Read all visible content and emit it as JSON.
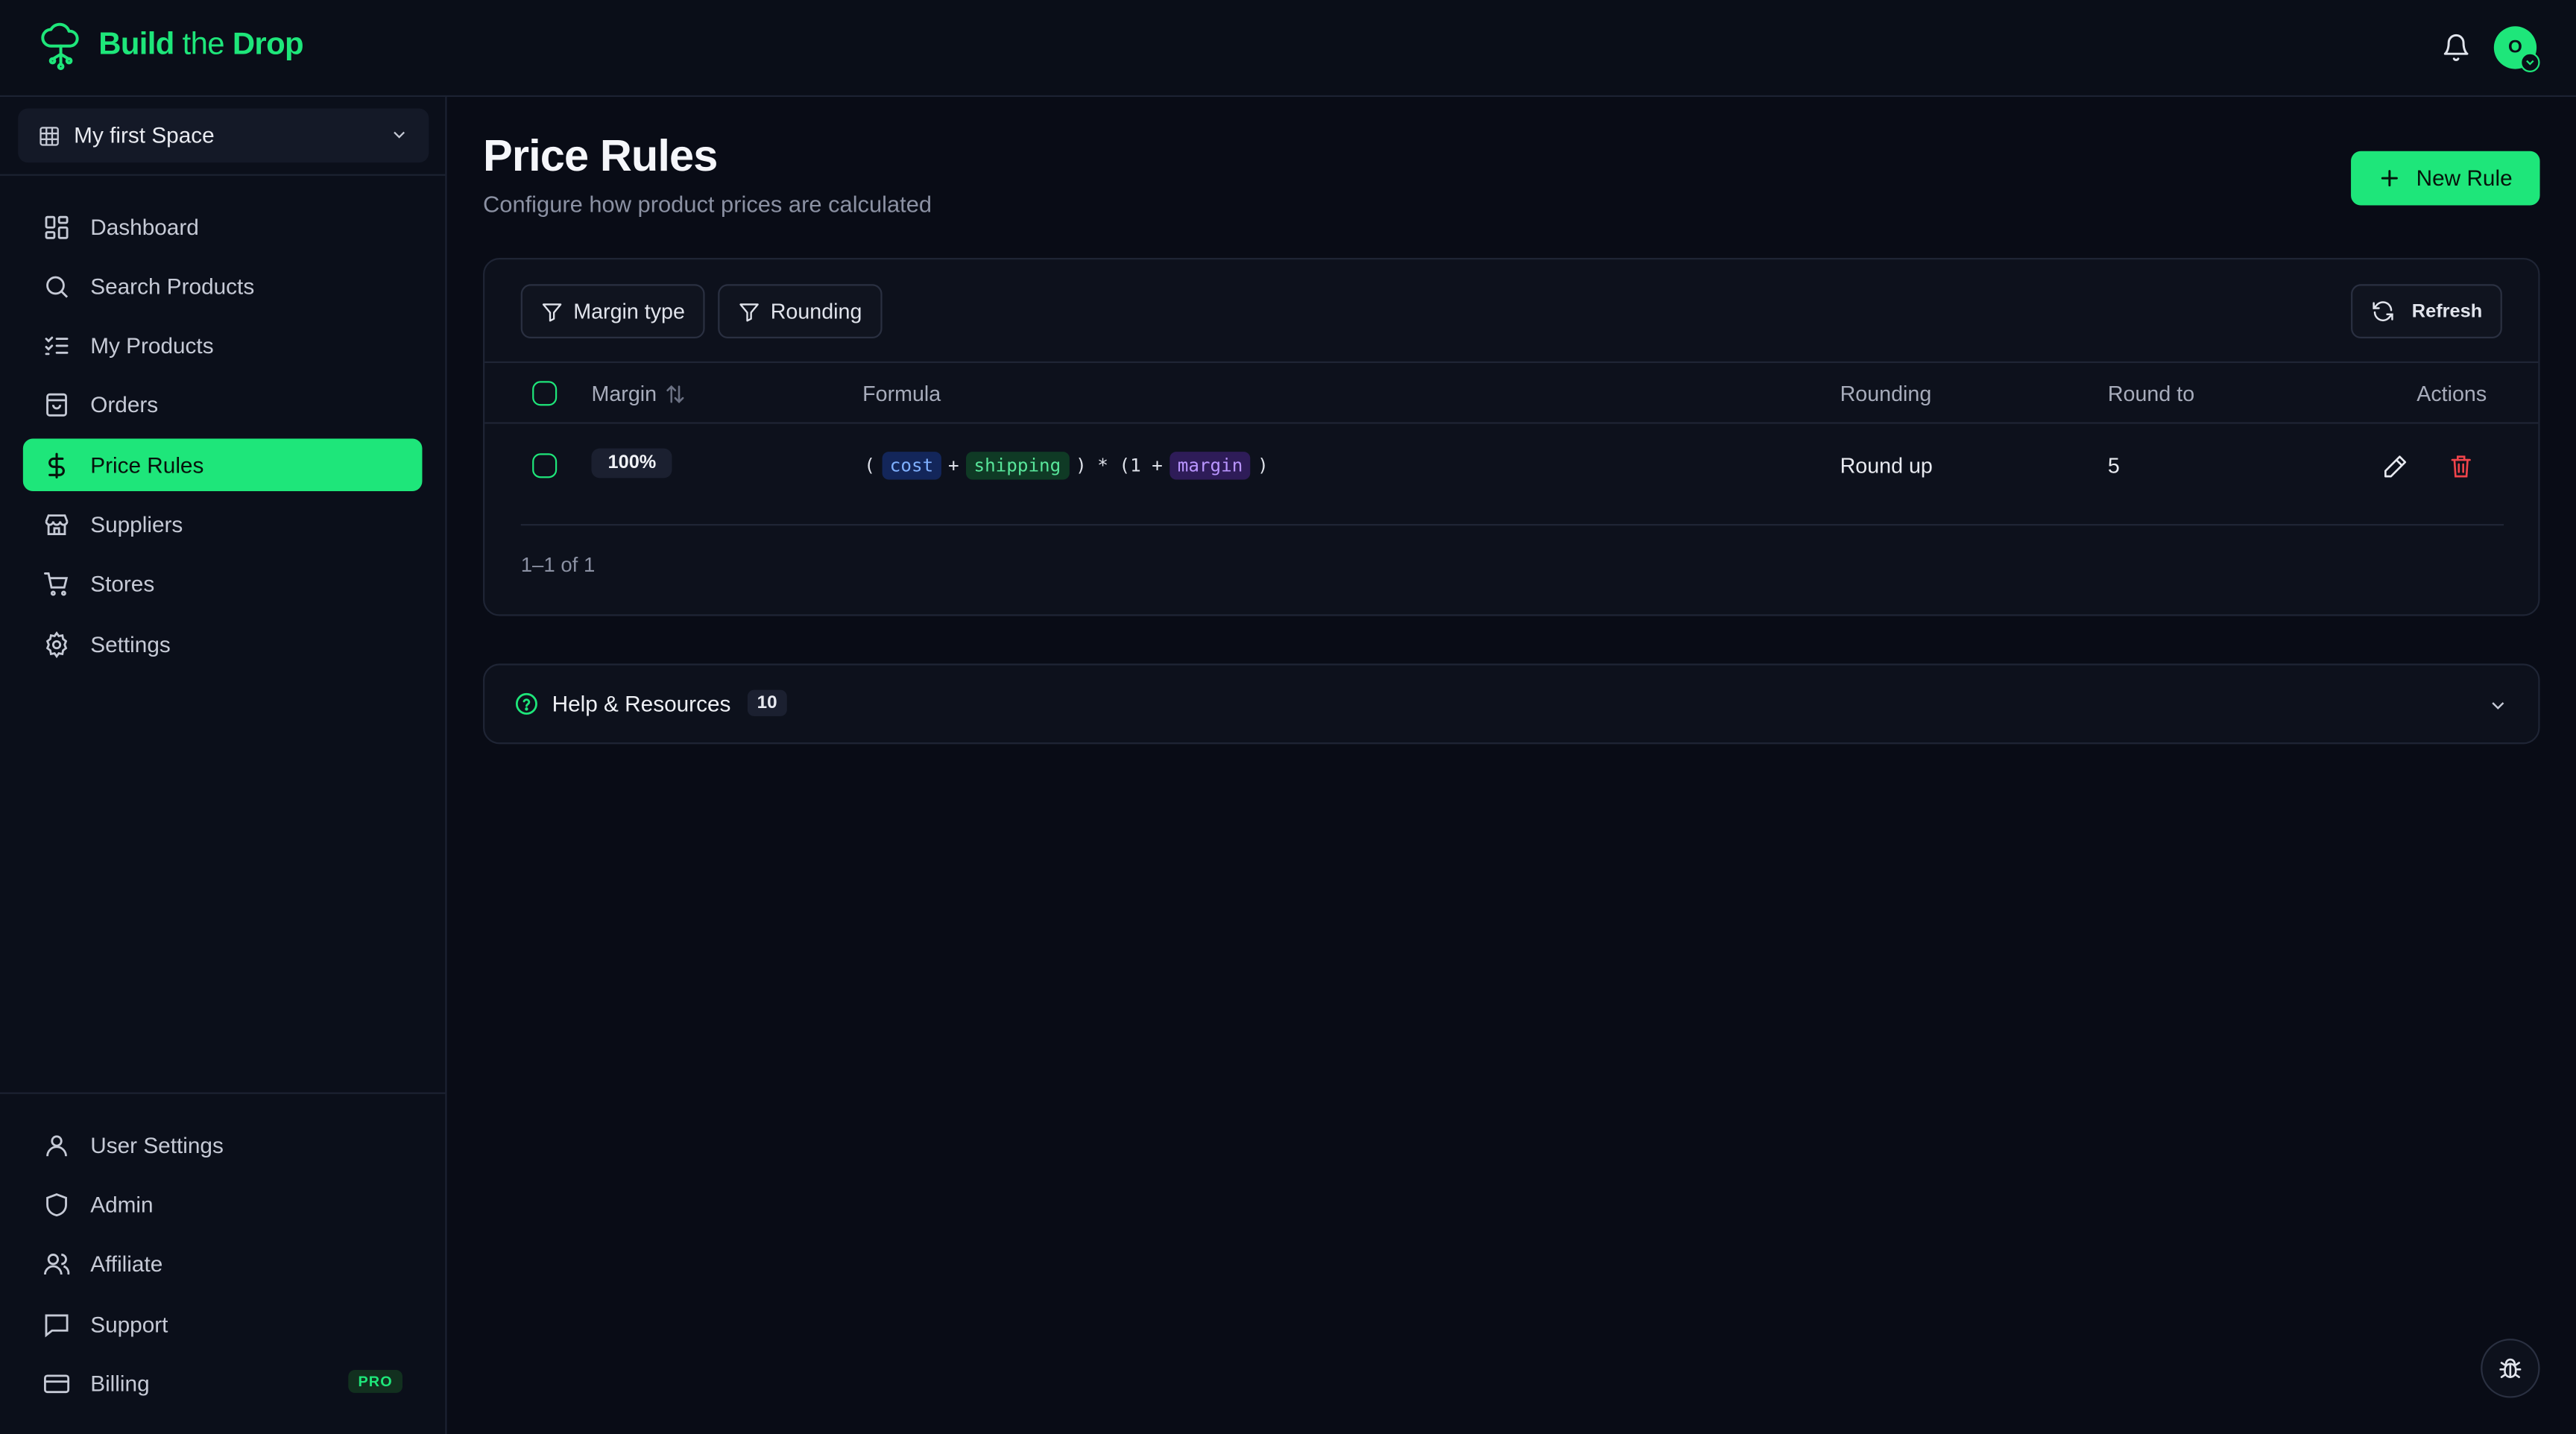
{
  "app": {
    "brand_bold": "Build",
    "brand_thin": "the",
    "brand_bold2": "Drop",
    "avatar_initial": "O"
  },
  "sidebar": {
    "space": "My first Space",
    "nav": [
      {
        "label": "Dashboard",
        "icon": "dashboard-icon"
      },
      {
        "label": "Search Products",
        "icon": "search-icon"
      },
      {
        "label": "My Products",
        "icon": "list-checks-icon"
      },
      {
        "label": "Orders",
        "icon": "shopping-bag-icon"
      },
      {
        "label": "Price Rules",
        "icon": "dollar-icon",
        "active": true
      },
      {
        "label": "Suppliers",
        "icon": "store-icon"
      },
      {
        "label": "Stores",
        "icon": "cart-icon"
      },
      {
        "label": "Settings",
        "icon": "gear-icon"
      }
    ],
    "bottom_nav": [
      {
        "label": "User Settings",
        "icon": "user-icon"
      },
      {
        "label": "Admin",
        "icon": "shield-icon"
      },
      {
        "label": "Affiliate",
        "icon": "users-icon"
      },
      {
        "label": "Support",
        "icon": "message-icon"
      },
      {
        "label": "Billing",
        "icon": "credit-card-icon",
        "badge": "PRO"
      }
    ]
  },
  "page": {
    "title": "Price Rules",
    "subtitle": "Configure how product prices are calculated",
    "new_rule_label": "New Rule"
  },
  "filters": {
    "margin_type": "Margin type",
    "rounding": "Rounding",
    "refresh": "Refresh"
  },
  "table": {
    "columns": {
      "margin": "Margin",
      "formula": "Formula",
      "rounding": "Rounding",
      "round_to": "Round to",
      "actions": "Actions"
    },
    "rows": [
      {
        "margin": "100%",
        "formula": {
          "open": "(",
          "cost": "cost",
          "plus1": "+",
          "shipping": "shipping",
          "close_mul": ") * (1 +",
          "margin": "margin",
          "close": ")"
        },
        "rounding": "Round up",
        "round_to": "5"
      }
    ],
    "pagination": "1–1 of 1"
  },
  "help": {
    "label": "Help & Resources",
    "count": "10"
  },
  "colors": {
    "accent": "#1ee67a",
    "danger": "#f0444b",
    "background": "#090c16"
  }
}
